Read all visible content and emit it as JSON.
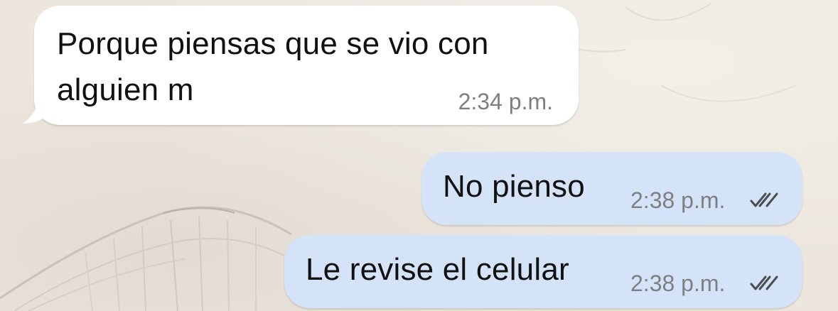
{
  "chat": {
    "messages": [
      {
        "direction": "incoming",
        "text_line1": "Porque piensas que se vio con",
        "text_line2": "alguien m",
        "time": "2:34 p.m."
      },
      {
        "direction": "outgoing",
        "text": "No pienso",
        "time": "2:38 p.m.",
        "status_icon": "double-check-icon"
      },
      {
        "direction": "outgoing",
        "text": "Le revise el celular",
        "time": "2:38 p.m.",
        "status_icon": "double-check-icon"
      }
    ]
  },
  "colors": {
    "incoming_bubble": "#ffffff",
    "outgoing_bubble": "#d5e3f8",
    "timestamp": "#7d7f82",
    "ticks": "#4a4d52",
    "wallpaper": "#ece6dd"
  }
}
